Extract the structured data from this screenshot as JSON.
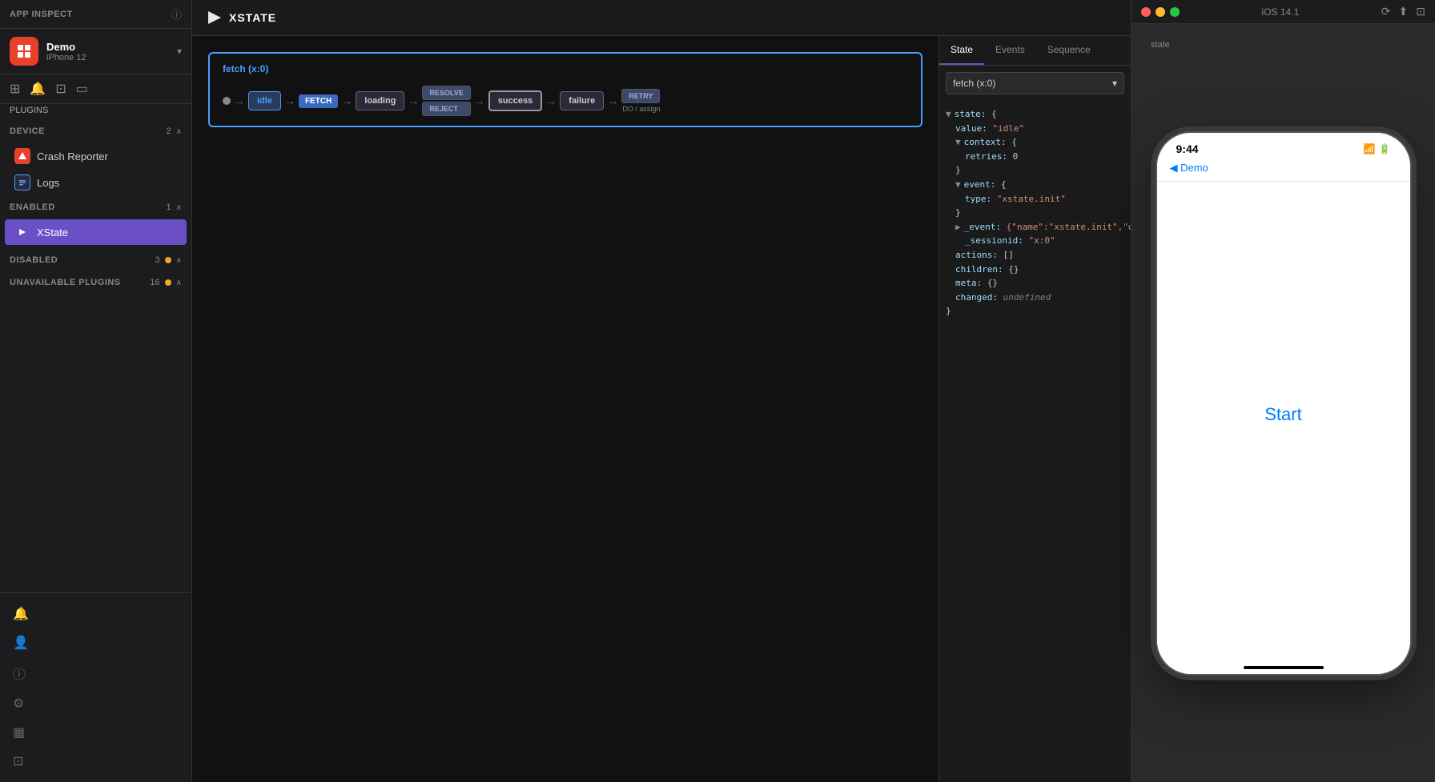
{
  "app": {
    "title": "APP INSPECT",
    "info_icon": "ⓘ"
  },
  "device_selector": {
    "app_name": "Demo",
    "device": "iPhone 12",
    "chevron": "▾"
  },
  "nav_icons": {
    "grid": "⊞",
    "bell": "🔔",
    "camera": "⊡",
    "screen": "▭"
  },
  "plugins_label": "PLUGINS",
  "sections": {
    "device": {
      "label": "Device",
      "count": "2",
      "chevron": "∧",
      "items": [
        {
          "name": "Crash Reporter",
          "icon_color": "#e8402a"
        },
        {
          "name": "Logs",
          "icon_color": "#4a9eff"
        }
      ]
    },
    "enabled": {
      "label": "Enabled",
      "count": "1",
      "chevron": "∧",
      "items": [
        {
          "name": "XState",
          "icon_color": "#6b4fc7",
          "active": true
        }
      ]
    },
    "disabled": {
      "label": "Disabled",
      "count": "3",
      "chevron": "∧",
      "has_dot": true
    },
    "unavailable": {
      "label": "Unavailable plugins",
      "count": "16",
      "chevron": "∧",
      "has_dot": true
    }
  },
  "xstate": {
    "logo_text": "XSTATE",
    "fetch_label": "fetch (x:0)",
    "states": {
      "idle": "idle",
      "fetch_event": "FETCH",
      "loading": "loading",
      "resolve": "RESOLVE",
      "reject": "REJECT",
      "success": "success",
      "failure": "failure",
      "retry": "RETRY",
      "do_assign": "DO / assign"
    }
  },
  "right_panel": {
    "tabs": [
      {
        "label": "State",
        "active": true
      },
      {
        "label": "Events"
      },
      {
        "label": "Sequence"
      }
    ],
    "state_select": {
      "value": "fetch (x:0)",
      "chevron": "▾"
    },
    "tree": [
      {
        "indent": 0,
        "content": "▼ state: {",
        "toggle": true
      },
      {
        "indent": 1,
        "key": "value:",
        "value": "\"idle\"",
        "type": "string"
      },
      {
        "indent": 1,
        "content": "▼ context: {",
        "toggle": true
      },
      {
        "indent": 2,
        "key": "retries:",
        "value": "0",
        "type": "number"
      },
      {
        "indent": 1,
        "content": "}",
        "toggle": false
      },
      {
        "indent": 1,
        "content": "▼ event: {",
        "toggle": true
      },
      {
        "indent": 2,
        "key": "type:",
        "value": "\"xstate.init\"",
        "type": "string"
      },
      {
        "indent": 1,
        "content": "}",
        "toggle": false
      },
      {
        "indent": 1,
        "key": "_event:",
        "value": "{\"name\":\"xstate.init\",\"da...",
        "type": "string"
      },
      {
        "indent": 2,
        "key": "_sessionid:",
        "value": "\"x:0\"",
        "type": "string"
      },
      {
        "indent": 1,
        "key": "actions:",
        "value": "[]",
        "type": "bracket"
      },
      {
        "indent": 1,
        "key": "children:",
        "value": "{}",
        "type": "bracket"
      },
      {
        "indent": 1,
        "key": "meta:",
        "value": "{}",
        "type": "bracket"
      },
      {
        "indent": 1,
        "key": "changed:",
        "value": "undefined",
        "type": "undefined"
      },
      {
        "indent": 0,
        "content": "}",
        "toggle": false
      }
    ]
  },
  "simulator": {
    "title": "iOS 14.1",
    "state_label": "state",
    "phone": {
      "time": "9:44",
      "back_label": "◀ Demo",
      "nav_title": "",
      "start_button": "Start"
    }
  },
  "bottom_icons": [
    "🔔",
    "👤",
    "ⓘ",
    "⚙",
    "▦",
    "⊡"
  ]
}
